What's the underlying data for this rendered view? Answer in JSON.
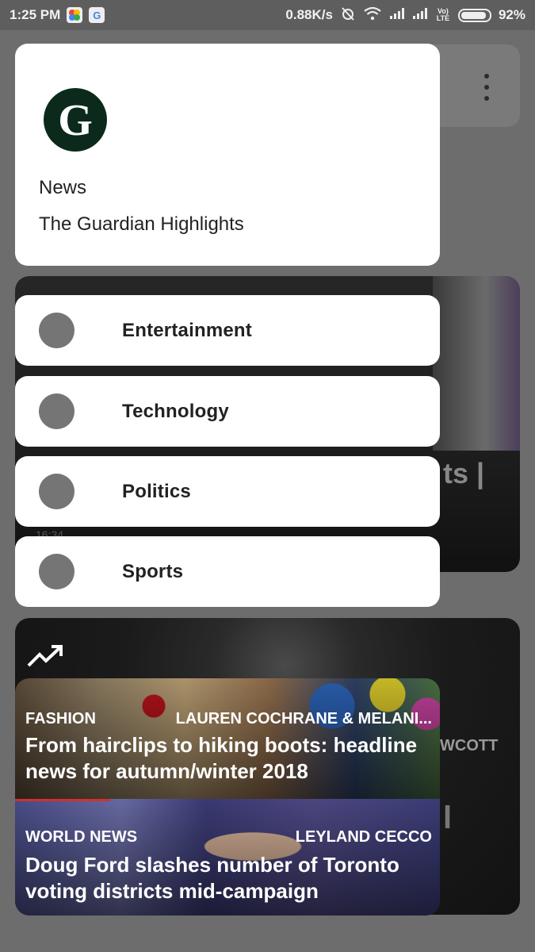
{
  "status_bar": {
    "time": "1:25 PM",
    "speed": "0.88K/s",
    "lte": "Vo) LTE",
    "battery": "92%"
  },
  "background": {
    "card1_ghost_text": "ts |",
    "card1_time": "16:34",
    "card2_ghost_author": "WCOTT",
    "card2_ghost_letter": "l"
  },
  "header": {
    "logo_letter": "G",
    "section": "News",
    "title": "The Guardian Highlights"
  },
  "categories": [
    {
      "label": "Entertainment"
    },
    {
      "label": "Technology"
    },
    {
      "label": "Politics"
    },
    {
      "label": "Sports"
    }
  ],
  "articles": [
    {
      "section": "FASHION",
      "author": "LAUREN COCHRANE & MELANI...",
      "headline": "From hairclips to hiking boots: headline news for autumn/winter 2018"
    },
    {
      "section": "WORLD NEWS",
      "author": "LEYLAND CECCO",
      "headline": "Doug Ford slashes number of Toronto voting districts mid-campaign"
    }
  ],
  "colors": {
    "guardian_green": "#052962",
    "logo_fill": "#0b2a1c",
    "dot": "#757575"
  },
  "icons": {
    "trending": "trending-up-icon",
    "menu": "more-vert-icon"
  }
}
